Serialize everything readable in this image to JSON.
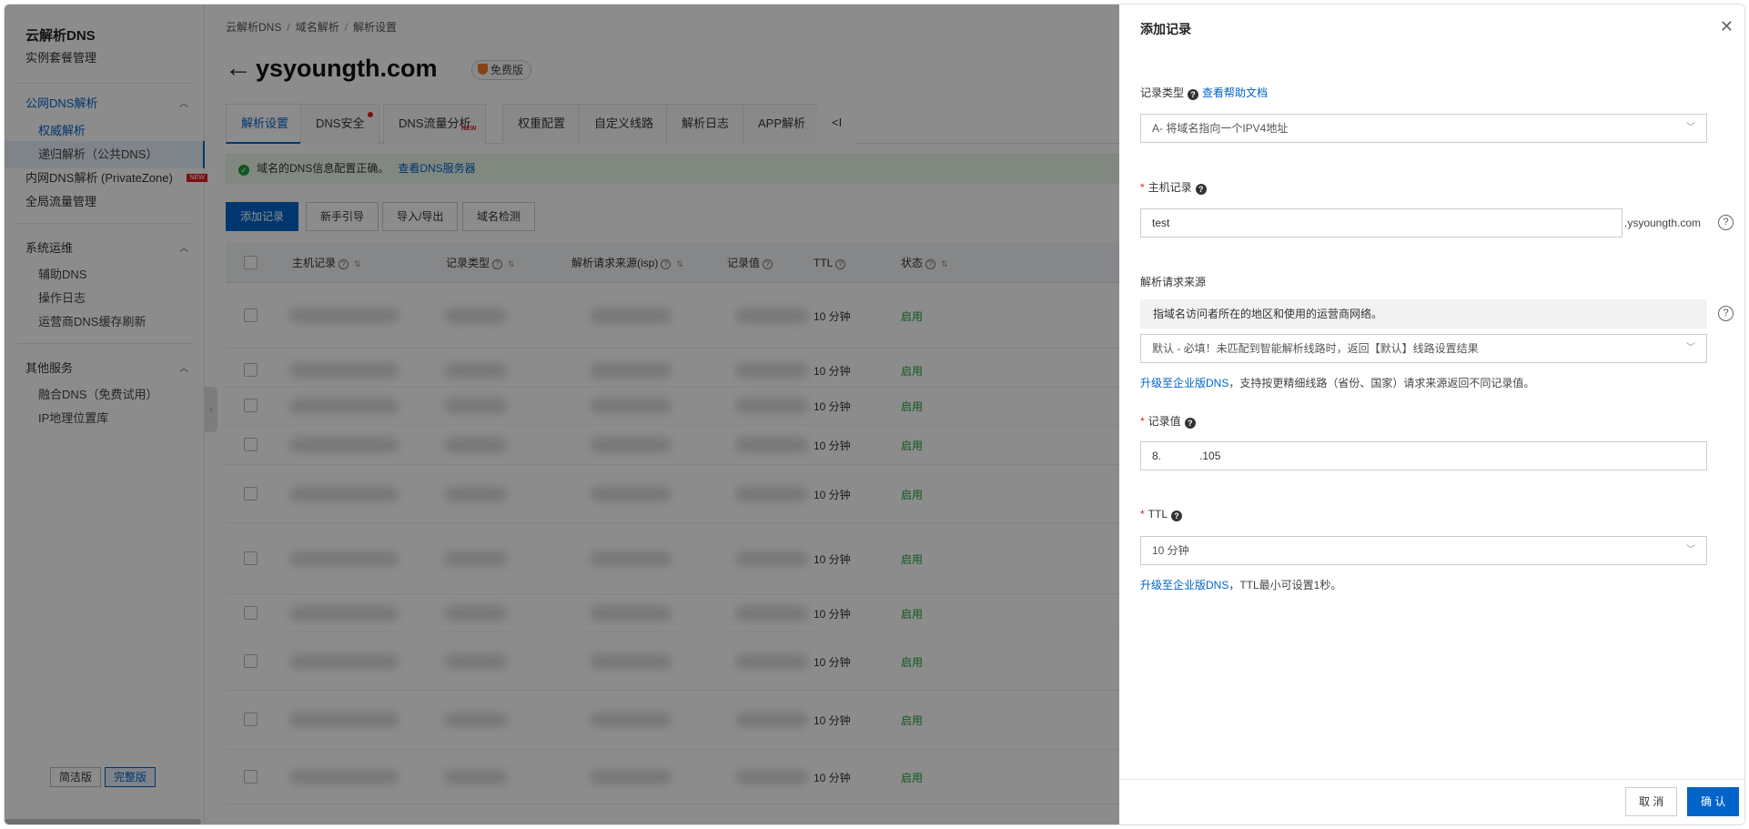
{
  "sidebar": {
    "title": "云解析DNS",
    "instance": "实例套餐管理",
    "public_dns": "公网DNS解析",
    "authoritative": "权威解析",
    "recursive": "递归解析（公共DNS）",
    "private_zone": "内网DNS解析 (PrivateZone)",
    "private_zone_badge": "NEW",
    "gtm": "全局流量管理",
    "ops": "系统运维",
    "aux_dns": "辅助DNS",
    "op_log": "操作日志",
    "isp_refresh": "运营商DNS缓存刷新",
    "other": "其他服务",
    "fusion_dns": "融合DNS（免费试用）",
    "ip_geo": "IP地理位置库",
    "simple_label": "简洁版",
    "full_label": "完整版"
  },
  "main": {
    "breadcrumb": [
      "云解析DNS",
      "域名解析",
      "解析设置"
    ],
    "domain": "ysyoungth.com",
    "plan_badge": "免费版",
    "tabs": [
      "解析设置",
      "DNS安全",
      "DNS流量分析",
      "权重配置",
      "自定义线路",
      "解析日志",
      "APP解析",
      "<I"
    ],
    "tab_new_badge": "NEW",
    "alert_text": "域名的DNS信息配置正确。",
    "alert_link": "查看DNS服务器",
    "buttons": [
      "添加记录",
      "新手引导",
      "导入/导出",
      "域名检测"
    ],
    "columns": [
      "主机记录",
      "记录类型",
      "解析请求来源(isp)",
      "记录值",
      "TTL",
      "状态"
    ],
    "rows": [
      {
        "ttl": "10 分钟",
        "status": "启用"
      },
      {
        "ttl": "10 分钟",
        "status": "启用"
      },
      {
        "ttl": "10 分钟",
        "status": "启用"
      },
      {
        "ttl": "10 分钟",
        "status": "启用"
      },
      {
        "ttl": "10 分钟",
        "status": "启用"
      },
      {
        "ttl": "10 分钟",
        "status": "启用"
      },
      {
        "ttl": "10 分钟",
        "status": "启用"
      },
      {
        "ttl": "10 分钟",
        "status": "启用"
      },
      {
        "ttl": "10 分钟",
        "status": "启用"
      },
      {
        "ttl": "10 分钟",
        "status": "启用"
      }
    ]
  },
  "drawer": {
    "title": "添加记录",
    "record_type_label": "记录类型",
    "record_type_help_link": "查看帮助文档",
    "record_type_value": "A- 将域名指向一个IPV4地址",
    "host_label": "主机记录",
    "host_value": "test",
    "host_suffix": ".ysyoungth.com",
    "source_label": "解析请求来源",
    "source_hint": "指域名访问者所在的地区和使用的运营商网络。",
    "source_value": "默认 - 必填！未匹配到智能解析线路时，返回【默认】线路设置结果",
    "source_upgrade_link": "升级至企业版DNS",
    "source_upgrade_text": "，支持按更精细线路（省份、国家）请求来源返回不同记录值。",
    "value_label": "记录值",
    "value_prefix": "8.",
    "value_suffix": ".105",
    "ttl_label": "TTL",
    "ttl_value": "10 分钟",
    "ttl_upgrade_link": "升级至企业版DNS",
    "ttl_upgrade_text": "，TTL最小可设置1秒。",
    "cancel": "取 消",
    "confirm": "确 认"
  },
  "colors": {
    "accent": "#0064c8",
    "success": "#1d9e3a",
    "danger": "#e02020"
  }
}
